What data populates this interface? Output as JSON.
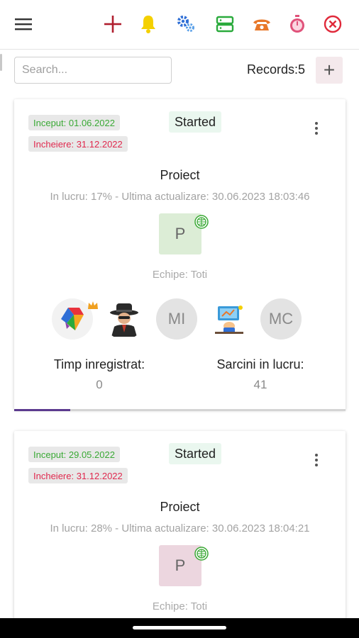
{
  "toolbar": {
    "icons": [
      "menu-icon",
      "plus-icon",
      "bell-icon",
      "gears-icon",
      "server-icon",
      "phone-icon",
      "stopwatch-icon",
      "close-circle-icon"
    ],
    "colors": {
      "plus": "#b01e2e",
      "bell": "#f4d000",
      "gears": "#2f6fd6",
      "server": "#2aaa3c",
      "phone": "#e8782a",
      "stopwatch": "#e0527a",
      "close": "#e0293a"
    }
  },
  "search": {
    "placeholder": "Search..."
  },
  "records_label": "Records:5",
  "add_label": "+",
  "projects": [
    {
      "start": "Inceput: 01.06.2022",
      "end": "Incheiere: 31.12.2022",
      "status": "Started",
      "title": "Proiect",
      "subtitle": "In lucru: 17% - Ultima actualizare: 30.06.2023 18:03:46",
      "avatar_letter": "P",
      "avatar_color": "#dcedd6",
      "teams": "Echipe: Toti",
      "members": [
        {
          "type": "logo",
          "name": "colorful-logo-avatar"
        },
        {
          "type": "image",
          "name": "spy-avatar"
        },
        {
          "type": "initials",
          "text": "MI"
        },
        {
          "type": "image",
          "name": "desk-illustration-avatar"
        },
        {
          "type": "initials",
          "text": "MC"
        }
      ],
      "time_label": "Timp inregistrat:",
      "time_value": "0",
      "tasks_label": "Sarcini in lucru:",
      "tasks_value": "41",
      "progress": 0.17
    },
    {
      "start": "Inceput: 29.05.2022",
      "end": "Incheiere: 31.12.2022",
      "status": "Started",
      "title": "Proiect",
      "subtitle": "In lucru: 28% - Ultima actualizare: 30.06.2023 18:04:21",
      "avatar_letter": "P",
      "avatar_color": "#ecd6df",
      "teams": "Echipe: Toti"
    }
  ]
}
